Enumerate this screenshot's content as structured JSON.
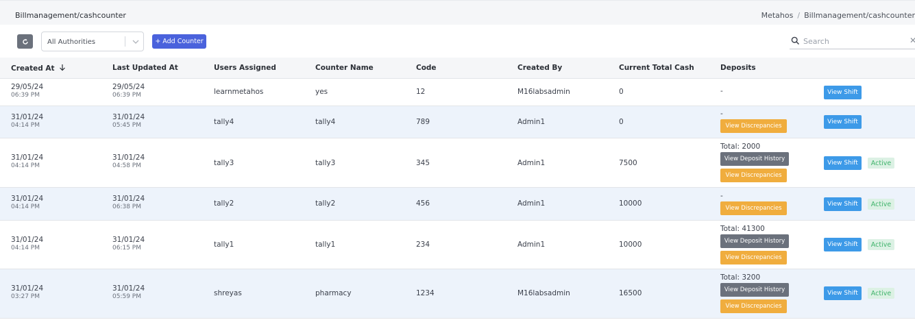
{
  "header": {
    "page_title": "Billmanagement/cashcounter",
    "breadcrumb": [
      "Metahos",
      "Billmanagement/cashcounter"
    ]
  },
  "toolbar": {
    "authority_select_value": "All Authorities",
    "add_counter_label": "Add Counter",
    "search_placeholder": "Search",
    "search_value": ""
  },
  "table": {
    "columns": [
      "Created At",
      "Last Updated At",
      "Users Assigned",
      "Counter Name",
      "Code",
      "Created By",
      "Current Total Cash",
      "Deposits"
    ],
    "sort_column": "Created At",
    "rows": [
      {
        "created_date": "29/05/24",
        "created_time": "06:39 PM",
        "updated_date": "29/05/24",
        "updated_time": "06:39 PM",
        "users": "learnmetahos",
        "counter": "yes",
        "code": "12",
        "created_by": "M16labsadmin",
        "cash": "0",
        "deposit_text": "-",
        "history": "",
        "discrepancies": "",
        "shift": "View Shift",
        "status": ""
      },
      {
        "created_date": "31/01/24",
        "created_time": "04:14 PM",
        "updated_date": "31/01/24",
        "updated_time": "05:45 PM",
        "users": "tally4",
        "counter": "tally4",
        "code": "789",
        "created_by": "Admin1",
        "cash": "0",
        "deposit_text": "-",
        "history": "",
        "discrepancies": "View Discrepancies",
        "shift": "View Shift",
        "status": ""
      },
      {
        "created_date": "31/01/24",
        "created_time": "04:14 PM",
        "updated_date": "31/01/24",
        "updated_time": "04:58 PM",
        "users": "tally3",
        "counter": "tally3",
        "code": "345",
        "created_by": "Admin1",
        "cash": "7500",
        "deposit_text": "Total: 2000",
        "history": "View Deposit History",
        "discrepancies": "View Discrepancies",
        "shift": "View Shift",
        "status": "Active"
      },
      {
        "created_date": "31/01/24",
        "created_time": "04:14 PM",
        "updated_date": "31/01/24",
        "updated_time": "06:38 PM",
        "users": "tally2",
        "counter": "tally2",
        "code": "456",
        "created_by": "Admin1",
        "cash": "10000",
        "deposit_text": "-",
        "history": "",
        "discrepancies": "View Discrepancies",
        "shift": "View Shift",
        "status": "Active"
      },
      {
        "created_date": "31/01/24",
        "created_time": "04:14 PM",
        "updated_date": "31/01/24",
        "updated_time": "06:15 PM",
        "users": "tally1",
        "counter": "tally1",
        "code": "234",
        "created_by": "Admin1",
        "cash": "10000",
        "deposit_text": "Total: 41300",
        "history": "View Deposit History",
        "discrepancies": "View Discrepancies",
        "shift": "View Shift",
        "status": "Active"
      },
      {
        "created_date": "31/01/24",
        "created_time": "03:27 PM",
        "updated_date": "31/01/24",
        "updated_time": "05:59 PM",
        "users": "shreyas",
        "counter": "pharmacy",
        "code": "1234",
        "created_by": "M16labsadmin",
        "cash": "16500",
        "deposit_text": "Total: 3200",
        "history": "View Deposit History",
        "discrepancies": "View Discrepancies",
        "shift": "View Shift",
        "status": "Active"
      }
    ]
  },
  "colors": {
    "primary": "#4a62dc",
    "shift_button": "#3d9ae8",
    "history_button": "#6b717c",
    "discrepancy_button": "#f0ad3e",
    "active_text": "#3fb36b",
    "active_bg": "#dcf1e4",
    "alt_row": "#edf3fb"
  },
  "icons": {
    "refresh": "refresh-icon",
    "dropdown": "chevron-down-icon",
    "add": "plus-icon",
    "search": "search-icon",
    "clear": "close-icon",
    "sort": "arrow-down-icon"
  }
}
